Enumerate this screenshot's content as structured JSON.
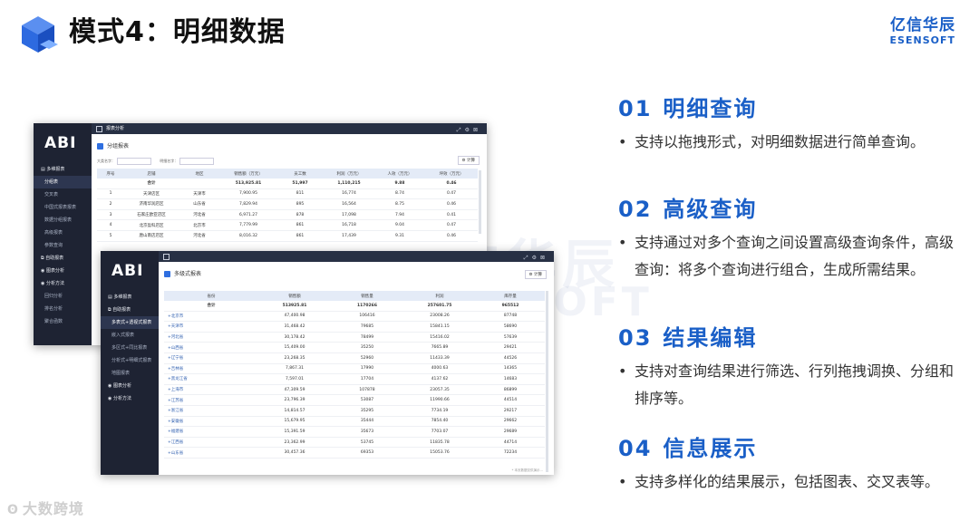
{
  "slide": {
    "title": "模式4：明细数据"
  },
  "brand": {
    "name_cn": "亿信华辰",
    "name_en": "ESENSOFT",
    "color": "#1a5fc7"
  },
  "watermark": {
    "cn": "亿信华辰",
    "en": "ESENSOFT"
  },
  "corner_logo": {
    "icon": "ring-logo-icon",
    "text": "大数跨境"
  },
  "features": [
    {
      "num": "01",
      "title": "明细查询",
      "desc": "支持以拖拽形式，对明细数据进行简单查询。"
    },
    {
      "num": "02",
      "title": "高级查询",
      "desc": "支持通过对多个查询之间设置高级查询条件，高级查询：将多个查询进行组合，生成所需结果。"
    },
    {
      "num": "03",
      "title": "结果编辑",
      "desc": "支持对查询结果进行筛选、行列拖拽调换、分组和排序等。"
    },
    {
      "num": "04",
      "title": "信息展示",
      "desc": "支持多样化的结果展示，包括图表、交叉表等。"
    }
  ],
  "bullet": "•",
  "back_window": {
    "logo": "ABI",
    "topbar_title": "报表分析",
    "panel_title": "分组报表",
    "filter1_label": "大类名字：",
    "filter2_label": "明细名字：",
    "calc_label": "计算",
    "nav": [
      {
        "label": "▤ 多维报表",
        "kind": "group"
      },
      {
        "label": "分组表",
        "kind": "active"
      },
      {
        "label": "交叉表",
        "kind": "sub"
      },
      {
        "label": "中国式报表报表",
        "kind": "sub"
      },
      {
        "label": "数据分组报表",
        "kind": "sub"
      },
      {
        "label": "高级报表",
        "kind": "sub"
      },
      {
        "label": "参数查询",
        "kind": "sub"
      },
      {
        "label": "⧉ 自助报表",
        "kind": "group"
      },
      {
        "label": "◉ 图表分析",
        "kind": "group"
      },
      {
        "label": "◉ 分析方法",
        "kind": "group"
      },
      {
        "label": "回归分析",
        "kind": "sub"
      },
      {
        "label": "排名分析",
        "kind": "sub"
      },
      {
        "label": "聚合函数",
        "kind": "sub"
      }
    ],
    "headers": [
      "序号",
      "店铺",
      "地区",
      "销售额（万元）",
      "员工数",
      "利润（万元）",
      "人效（万元）",
      "坪效（万元）"
    ],
    "total": [
      "",
      "合计",
      "",
      "513,925.81",
      "51,997",
      "1,110,215",
      "9.88",
      "0.46"
    ],
    "rows": [
      [
        "1",
        "天津店区",
        "天津市",
        "7,900.95",
        "811",
        "16,774",
        "8.74",
        "0.47"
      ],
      [
        "2",
        "济南华润店区",
        "山东省",
        "7,829.94",
        "895",
        "16,564",
        "8.75",
        "0.46"
      ],
      [
        "3",
        "石家庄欧亚店区",
        "河北省",
        "6,971.27",
        "878",
        "17,098",
        "7.94",
        "0.41"
      ],
      [
        "4",
        "北京盈科店区",
        "北京市",
        "7,779.99",
        "861",
        "16,718",
        "9.04",
        "0.47"
      ],
      [
        "5",
        "唐山南店店区",
        "河北省",
        "8,016.32",
        "861",
        "17,439",
        "9.31",
        "0.46"
      ]
    ]
  },
  "front_window": {
    "logo": "ABI",
    "panel_title": "多级式报表",
    "calc_label": "计算",
    "footnote": "* 本页数据仅供演示…",
    "nav": [
      {
        "label": "▤ 多维报表",
        "kind": "group"
      },
      {
        "label": "⧉ 自助报表",
        "kind": "group"
      },
      {
        "label": "多表式+透视式报表",
        "kind": "active"
      },
      {
        "label": "嵌入式报表",
        "kind": "sub"
      },
      {
        "label": "多区式+同比报表",
        "kind": "sub"
      },
      {
        "label": "分析式+明细式报表",
        "kind": "sub"
      },
      {
        "label": "地图报表",
        "kind": "sub"
      },
      {
        "label": "◉ 图表分析",
        "kind": "group"
      },
      {
        "label": "◉ 分析方法",
        "kind": "group"
      }
    ],
    "headers": [
      "省份",
      "销售额",
      "销售量",
      "利润",
      "库存量"
    ],
    "total": [
      "合计",
      "513925.81",
      "1170266",
      "257601.75",
      "965512"
    ],
    "rows": [
      [
        "北京市",
        "47,400.98",
        "106416",
        "23008.26",
        "87748"
      ],
      [
        "天津市",
        "31,468.42",
        "79685",
        "15841.15",
        "58690"
      ],
      [
        "河北省",
        "30,178.42",
        "78499",
        "15416.02",
        "57639"
      ],
      [
        "山西省",
        "15,409.00",
        "35250",
        "7665.89",
        "29421"
      ],
      [
        "辽宁省",
        "23,268.35",
        "52960",
        "11433.39",
        "44526"
      ],
      [
        "吉林省",
        "7,867.31",
        "17990",
        "4000.63",
        "14365"
      ],
      [
        "黑龙江省",
        "7,597.01",
        "17704",
        "4137.62",
        "14683"
      ],
      [
        "上海市",
        "47,309.59",
        "107878",
        "23057.35",
        "86899"
      ],
      [
        "江苏省",
        "23,796.39",
        "53087",
        "11990.66",
        "44514"
      ],
      [
        "浙江省",
        "14,814.57",
        "35295",
        "7734.19",
        "29217"
      ],
      [
        "安徽省",
        "15,679.95",
        "35444",
        "7854.40",
        "29662"
      ],
      [
        "福建省",
        "15,391.59",
        "35673",
        "7703.07",
        "29689"
      ],
      [
        "江西省",
        "23,362.99",
        "53745",
        "11835.78",
        "44714"
      ],
      [
        "山东省",
        "30,457.36",
        "69353",
        "15053.76",
        "72234"
      ]
    ]
  }
}
